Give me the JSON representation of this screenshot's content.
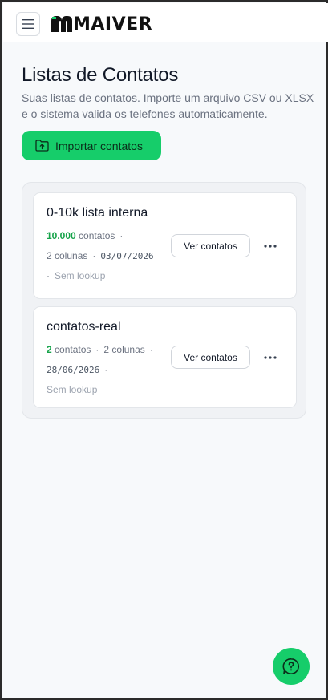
{
  "header": {
    "logo_text": "MAIVER",
    "menu_icon": "hamburger-icon"
  },
  "page": {
    "title": "Listas de Contatos",
    "subtitle": "Suas listas de contatos. Importe um arquivo CSV ou XLSX e o sistema valida os telefones automaticamente.",
    "import_button_label": "Importar contatos",
    "import_icon": "folder-upload-icon"
  },
  "lists": [
    {
      "name": "0-10k lista interna",
      "count": "10.000",
      "count_suffix": "contatos",
      "columns": "2 colunas",
      "date": "03/07/2026",
      "lookup": "Sem lookup",
      "view_label": "Ver contatos"
    },
    {
      "name": "contatos-real",
      "count": "2",
      "count_suffix": "contatos",
      "columns": "2 colunas",
      "date": "28/06/2026",
      "lookup": "Sem lookup",
      "view_label": "Ver contatos"
    }
  ],
  "fab": {
    "icon": "help-chat-icon"
  },
  "colors": {
    "accent": "#16cd6a",
    "count_green": "#16a34a",
    "background": "#f7f9fb"
  }
}
